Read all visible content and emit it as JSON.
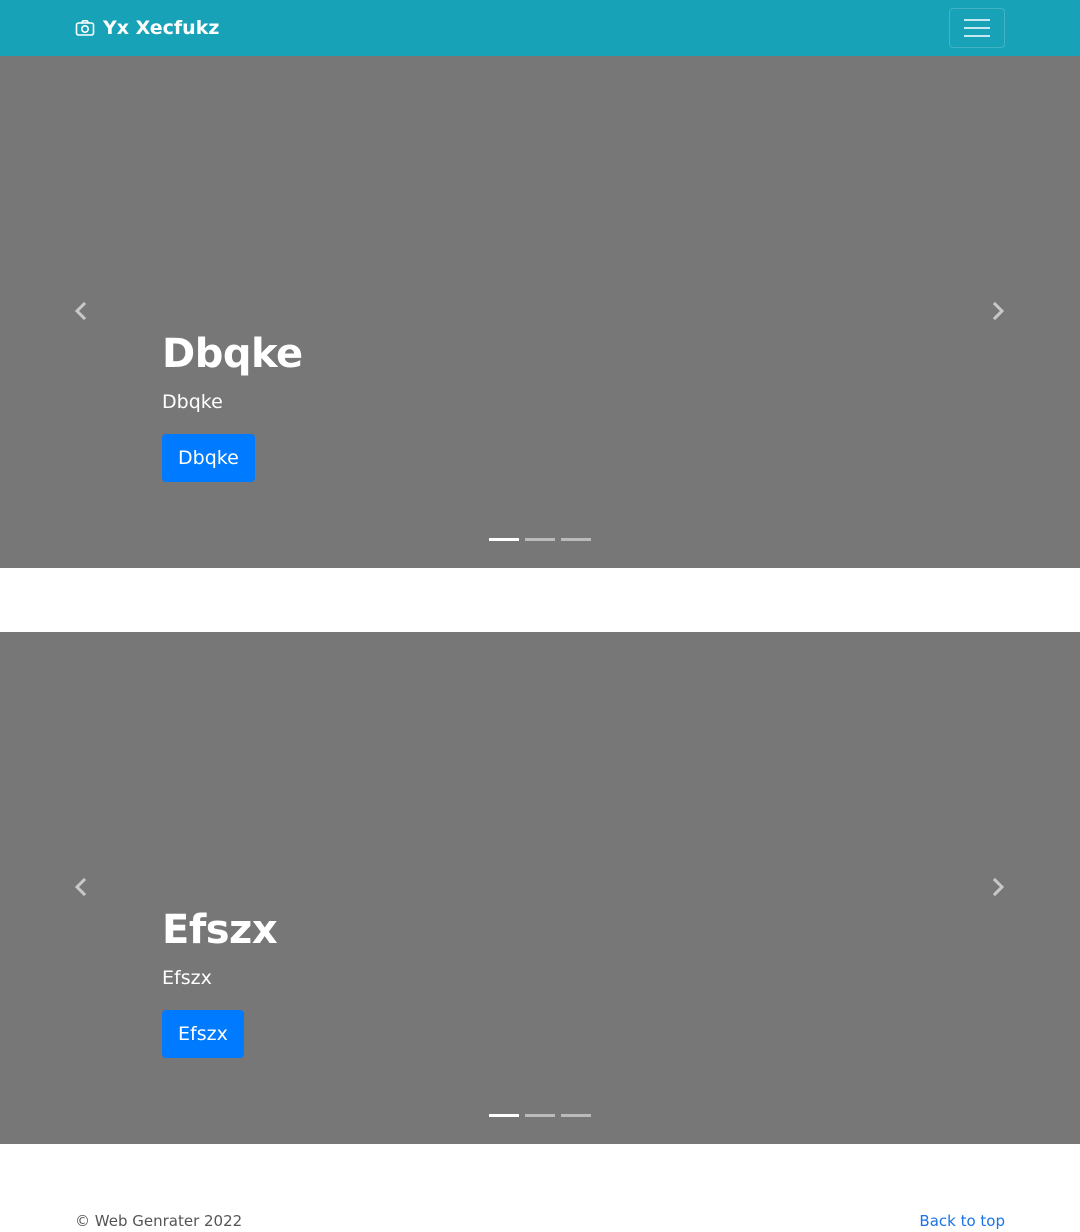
{
  "navbar": {
    "brand_icon": "camera-icon",
    "brand": "Yx Xecfukz",
    "toggler_icon": "hamburger-menu-icon",
    "background": "#17a2b8"
  },
  "carousels": [
    {
      "heading": "Dbqke",
      "text": "Dbqke",
      "button": "Dbqke",
      "prev_icon": "chevron-left-icon",
      "next_icon": "chevron-right-icon",
      "slide_count": 3,
      "active_slide": 1
    },
    {
      "heading": "Efszx",
      "text": "Efszx",
      "button": "Efszx",
      "prev_icon": "chevron-left-icon",
      "next_icon": "chevron-right-icon",
      "slide_count": 3,
      "active_slide": 1
    }
  ],
  "footer": {
    "copyright": "© Web Genrater 2022",
    "back_to_top": "Back to top"
  },
  "colors": {
    "navbar": "#17a2b8",
    "carousel_bg": "#777777",
    "button": "#007bff",
    "link": "#1a73e8"
  }
}
